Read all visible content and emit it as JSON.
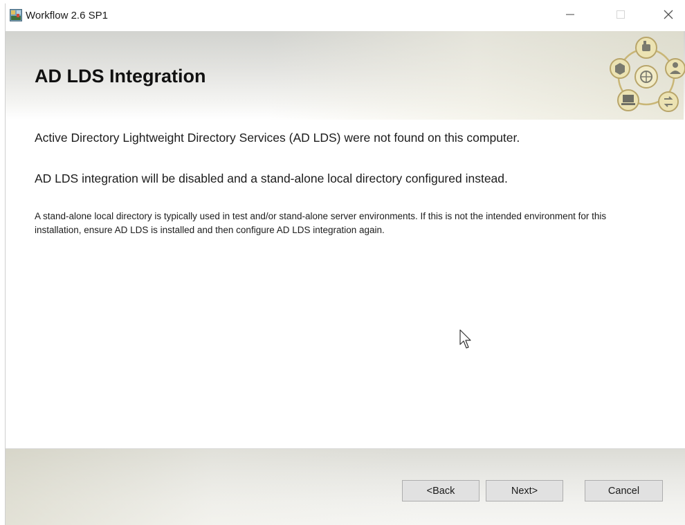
{
  "window": {
    "title": "Workflow 2.6 SP1",
    "controls": {
      "minimize": "minimize-icon",
      "maximize": "maximize-icon",
      "close": "close-icon"
    }
  },
  "header": {
    "title": "AD LDS Integration",
    "logo_icons": [
      "thumbs-up-icon",
      "person-icon",
      "arrows-icon",
      "computer-icon",
      "cube-icon",
      "globe-icon"
    ]
  },
  "content": {
    "message_1": "Active Directory Lightweight Directory Services (AD LDS) were not found on this computer.",
    "message_2": "AD LDS integration will be disabled and a stand-alone local directory configured instead.",
    "message_3": "A stand-alone local directory is typically used in test and/or stand-alone server environments. If this is not the intended environment for this installation, ensure AD LDS is installed and then configure AD LDS integration again."
  },
  "footer": {
    "back_label": "<Back",
    "next_label": "Next>",
    "cancel_label": "Cancel"
  },
  "colors": {
    "header_gradient_top": "#d2d3cf",
    "logo_gold": "#e9dfa8",
    "logo_outline": "#b8a56a",
    "button_face": "#e1e1e1",
    "button_border": "#adadad"
  }
}
